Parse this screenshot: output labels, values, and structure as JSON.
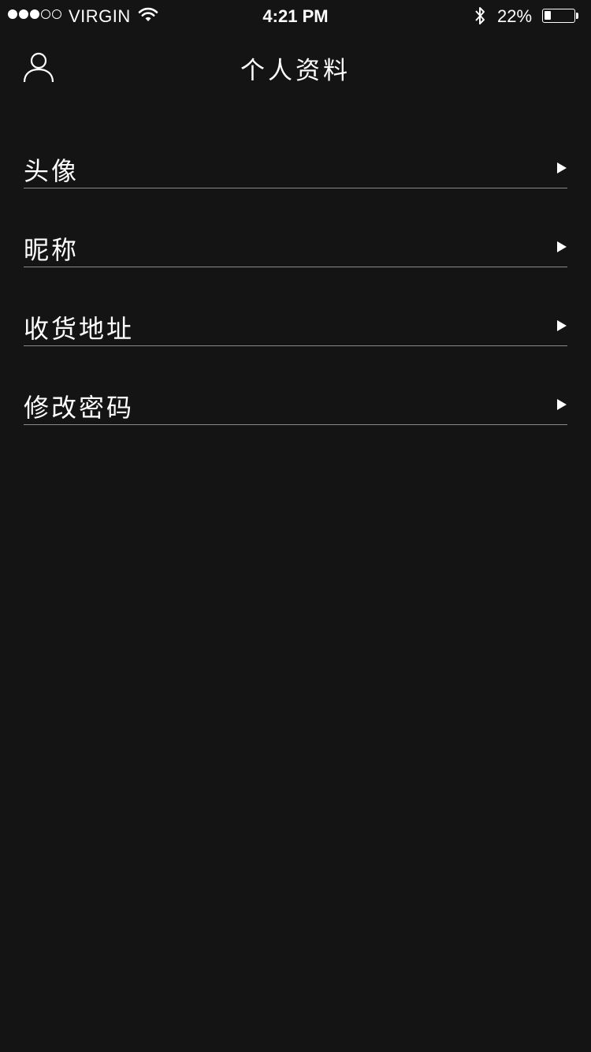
{
  "status_bar": {
    "carrier": "VIRGIN",
    "time": "4:21 PM",
    "battery_percent_label": "22%",
    "battery_level": 0.22,
    "signal_bars_filled": 3,
    "signal_bars_total": 5
  },
  "nav": {
    "title": "个人资料",
    "left_icon": "user-icon"
  },
  "menu": {
    "items": [
      {
        "label": "头像",
        "icon": "chevron-right-icon"
      },
      {
        "label": "昵称",
        "icon": "chevron-right-icon"
      },
      {
        "label": "收货地址",
        "icon": "chevron-right-icon"
      },
      {
        "label": "修改密码",
        "icon": "chevron-right-icon"
      }
    ]
  },
  "colors": {
    "background": "#141414",
    "text": "#ffffff",
    "divider": "#8a8a8a"
  }
}
